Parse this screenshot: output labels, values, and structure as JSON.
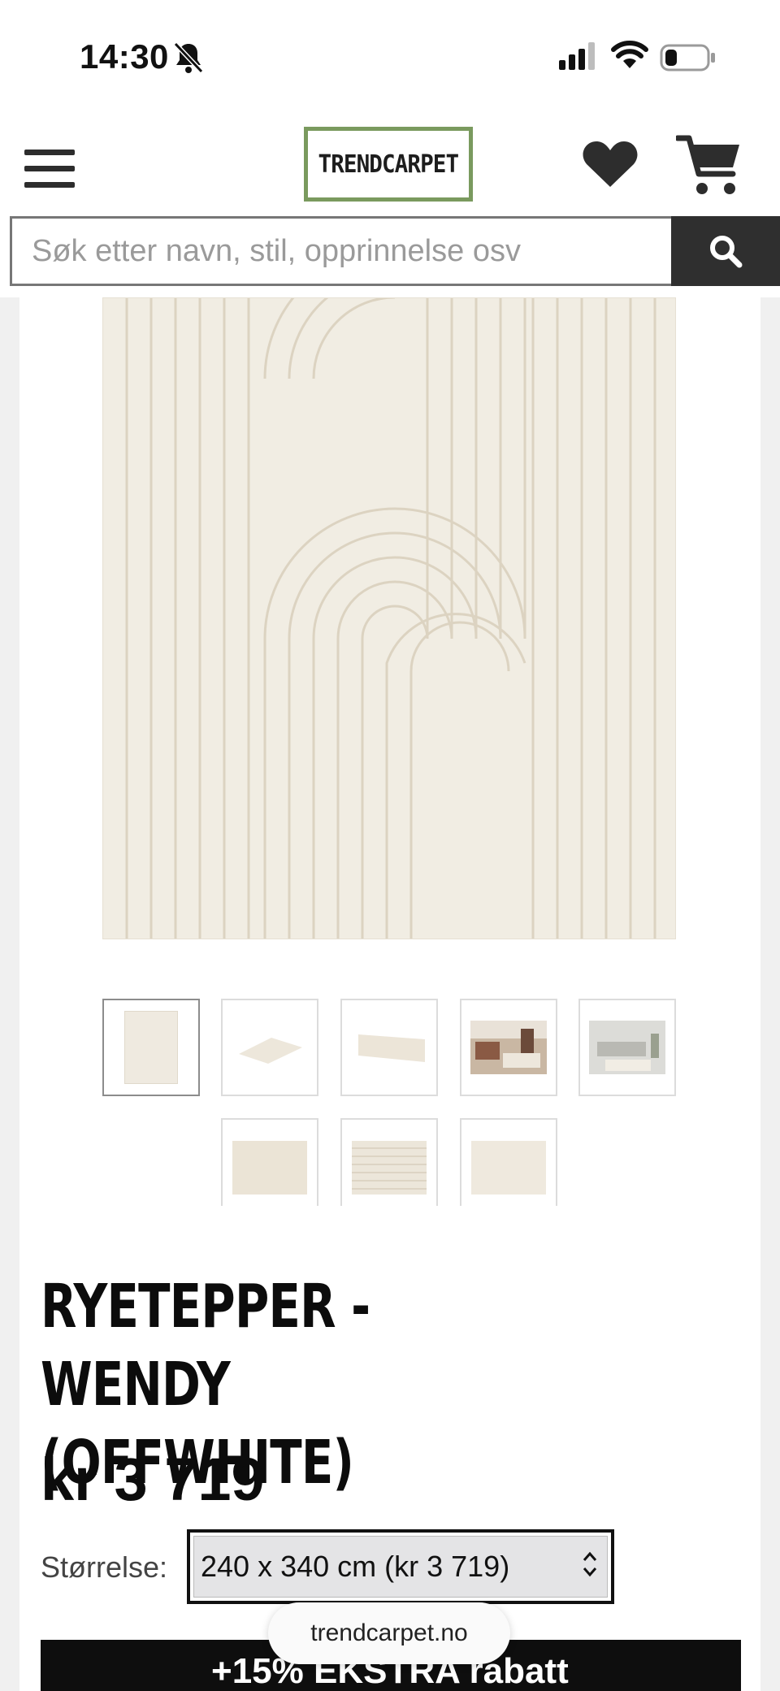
{
  "status_bar": {
    "time": "14:30",
    "silent_icon": "bell-slash-icon",
    "signal_icon": "cellular-signal-icon",
    "wifi_icon": "wifi-icon",
    "battery_icon": "battery-icon",
    "battery_level": 0.3
  },
  "header": {
    "menu_icon": "hamburger-menu-icon",
    "logo_text": "TRENDCARPET",
    "wishlist_icon": "heart-icon",
    "cart_icon": "shopping-cart-icon",
    "logo_border_color": "#7a9a5e"
  },
  "search": {
    "placeholder": "Søk etter navn, stil, opprinnelse osv",
    "value": "",
    "button_icon": "search-icon"
  },
  "gallery": {
    "main_image": "offwhite-shag-rug-arc-pattern",
    "thumbnails": [
      {
        "name": "rug-top-view",
        "active": true
      },
      {
        "name": "rug-angled-view",
        "active": false
      },
      {
        "name": "rug-closeup-angle",
        "active": false
      },
      {
        "name": "rug-living-room-1",
        "active": false
      },
      {
        "name": "rug-living-room-2",
        "active": false
      },
      {
        "name": "rug-texture-arcs",
        "active": false
      },
      {
        "name": "rug-texture-lines",
        "active": false
      },
      {
        "name": "rug-texture-detail",
        "active": false
      }
    ]
  },
  "product": {
    "title": "RYETEPPER - WENDY (OFFWHITE)",
    "price": "kr 3 719",
    "size_label": "Størrelse:",
    "size_selected": "240 x 340 cm (kr 3 719)"
  },
  "promo": {
    "text": "+15% EKSTRA rabatt"
  },
  "browser": {
    "url": "trendcarpet.no"
  }
}
